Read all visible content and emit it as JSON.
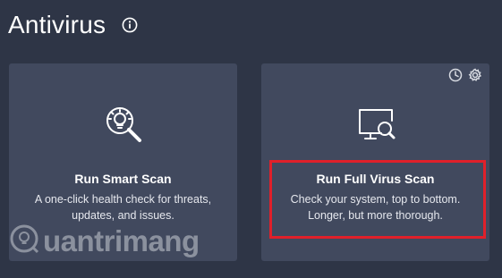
{
  "header": {
    "title": "Antivirus",
    "info_icon": "info-icon"
  },
  "cards": [
    {
      "icon": "smart-scan-bulb-magnifier-icon",
      "title": "Run Smart Scan",
      "description": "A one-click health check for threats, updates, and issues."
    },
    {
      "icon": "monitor-magnifier-icon",
      "title": "Run Full Virus Scan",
      "description": "Check your system, top to bottom. Longer, but more thorough.",
      "corner_icons": [
        "clock-icon",
        "gear-icon"
      ]
    }
  ],
  "annotation": {
    "highlight_color": "#e0202a"
  },
  "watermark": {
    "text": "uantrimang"
  },
  "colors": {
    "background": "#2e3546",
    "card": "#41495e",
    "text": "#ffffff"
  }
}
